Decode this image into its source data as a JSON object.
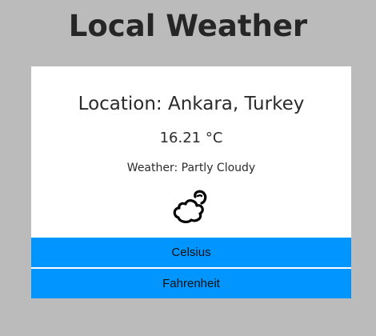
{
  "app": {
    "title": "Local Weather"
  },
  "weather": {
    "location_text": "Location: Ankara, Turkey",
    "temperature_text": "16.21 °C",
    "description_text": "Weather: Partly Cloudy",
    "icon": "partly-cloudy-icon"
  },
  "units": {
    "celsius_label": "Celsius",
    "fahrenheit_label": "Fahrenheit"
  },
  "colors": {
    "page_background": "#bbbbbb",
    "card_background": "#ffffff",
    "button_background": "#0095ff"
  }
}
